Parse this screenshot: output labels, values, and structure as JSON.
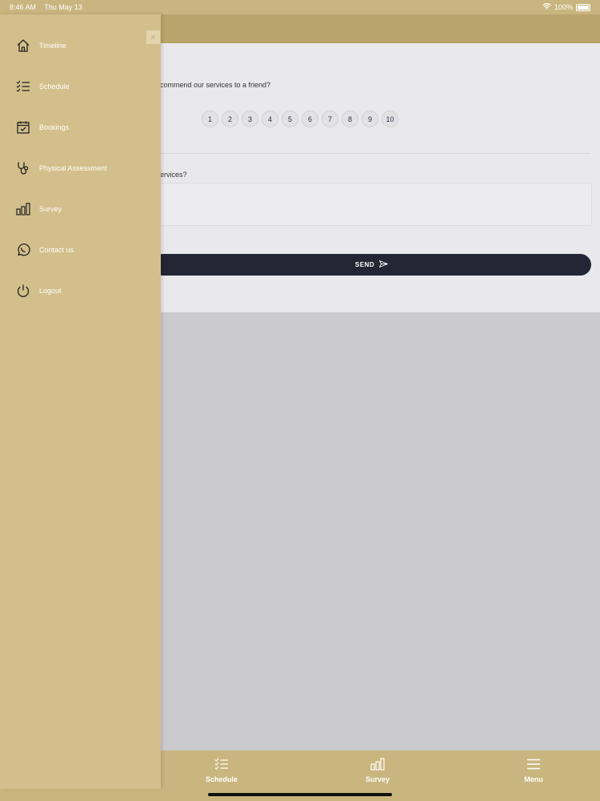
{
  "status_bar": {
    "time": "8:46 AM",
    "date": "Thu May 13",
    "battery": "100%"
  },
  "survey": {
    "question1": "commend our services to a friend?",
    "ratings": [
      "1",
      "2",
      "3",
      "4",
      "5",
      "6",
      "7",
      "8",
      "9",
      "10"
    ],
    "question2": "ervices?",
    "send_label": "SEND"
  },
  "drawer": {
    "close_label": "×",
    "items": [
      {
        "label": "Timeline",
        "icon": "home-icon"
      },
      {
        "label": "Schedule",
        "icon": "checklist-icon"
      },
      {
        "label": "Bookings",
        "icon": "calendar-check-icon"
      },
      {
        "label": "Physical Assessment",
        "icon": "stethoscope-icon"
      },
      {
        "label": "Survey",
        "icon": "bar-chart-icon"
      },
      {
        "label": "Contact us",
        "icon": "whatsapp-icon"
      },
      {
        "label": "Logout",
        "icon": "power-icon"
      }
    ]
  },
  "bottom_nav": {
    "items": [
      {
        "label": "Schedule",
        "icon": "checklist-icon"
      },
      {
        "label": "Survey",
        "icon": "bar-chart-icon"
      },
      {
        "label": "Menu",
        "icon": "hamburger-icon"
      }
    ]
  },
  "colors": {
    "gold": "#d3bf8b",
    "dark": "#242636"
  }
}
